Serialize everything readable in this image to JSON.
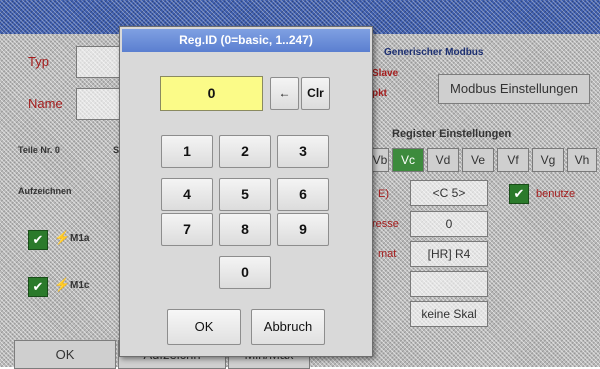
{
  "dialog": {
    "title": "Reg.ID (0=basic, 1..247)",
    "value": "0",
    "backspace_glyph": "←",
    "clear_label": "Clr",
    "keys": [
      "1",
      "2",
      "3",
      "4",
      "5",
      "6",
      "7",
      "8",
      "9",
      "0"
    ],
    "ok_label": "OK",
    "cancel_label": "Abbruch"
  },
  "background": {
    "typ_label": "Typ",
    "name_label": "Name",
    "generic_modbus_label": "Generischer Modbus",
    "slave_label": "Slave",
    "point_label": "pkt",
    "modbus_settings_label": "Modbus Einstellungen",
    "part_no_label": "Teile Nr. 0",
    "serial_prefix": "S",
    "register_settings_label": "Register Einstellungen",
    "value_tabs": [
      "Vb",
      "Vc",
      "Vd",
      "Ve",
      "Vf",
      "Vg",
      "Vh"
    ],
    "record_label": "Aufzeichnen",
    "channel_1": "M1a",
    "channel_2": "M1c",
    "channel_field_value": "<C 5>",
    "use_label": "benutze",
    "address_suffix": "resse",
    "address_value": "0",
    "format_suffix": "mat",
    "format_value": "[HR] R4",
    "scale_value": "keine Skal",
    "ok_button": "OK",
    "footer_btn_2": "Aufzeichn",
    "footer_btn_3": "Min/Max",
    "check_glyph": "✔",
    "spark_glyph": "⚡"
  }
}
